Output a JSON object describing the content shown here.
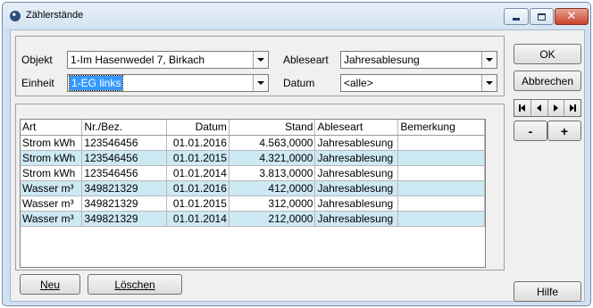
{
  "window": {
    "title": "Zählerstände"
  },
  "filters": {
    "objekt_label": "Objekt",
    "objekt_value": "1-Im Hasenwedel 7, Birkach",
    "ableseart_label": "Ableseart",
    "ableseart_value": "Jahresablesung",
    "einheit_label": "Einheit",
    "einheit_value": "1-EG links",
    "datum_label": "Datum",
    "datum_value": "<alle>"
  },
  "buttons": {
    "ok": "OK",
    "abbrechen": "Abbrechen",
    "minus": "-",
    "plus": "+",
    "neu": "Neu",
    "loeschen": "Löschen",
    "hilfe": "Hilfe"
  },
  "table": {
    "columns": [
      "Art",
      "Nr./Bez.",
      "Datum",
      "Stand",
      "Ableseart",
      "Bemerkung"
    ],
    "rows": [
      [
        "Strom kWh",
        "123546456",
        "01.01.2016",
        "4.563,0000",
        "Jahresablesung",
        ""
      ],
      [
        "Strom kWh",
        "123546456",
        "01.01.2015",
        "4.321,0000",
        "Jahresablesung",
        ""
      ],
      [
        "Strom kWh",
        "123546456",
        "01.01.2014",
        "3.813,0000",
        "Jahresablesung",
        ""
      ],
      [
        "Wasser m³",
        "349821329",
        "01.01.2016",
        "412,0000",
        "Jahresablesung",
        ""
      ],
      [
        "Wasser m³",
        "349821329",
        "01.01.2015",
        "312,0000",
        "Jahresablesung",
        ""
      ],
      [
        "Wasser m³",
        "349821329",
        "01.01.2014",
        "212,0000",
        "Jahresablesung",
        ""
      ]
    ]
  },
  "icons": {
    "app": "meter-app-icon",
    "nav": [
      "first-record-icon",
      "previous-record-icon",
      "next-record-icon",
      "last-record-icon"
    ]
  },
  "colors": {
    "row_alt": "#cde9f4",
    "selection": "#3399ff",
    "close_button": "#c7432a"
  }
}
